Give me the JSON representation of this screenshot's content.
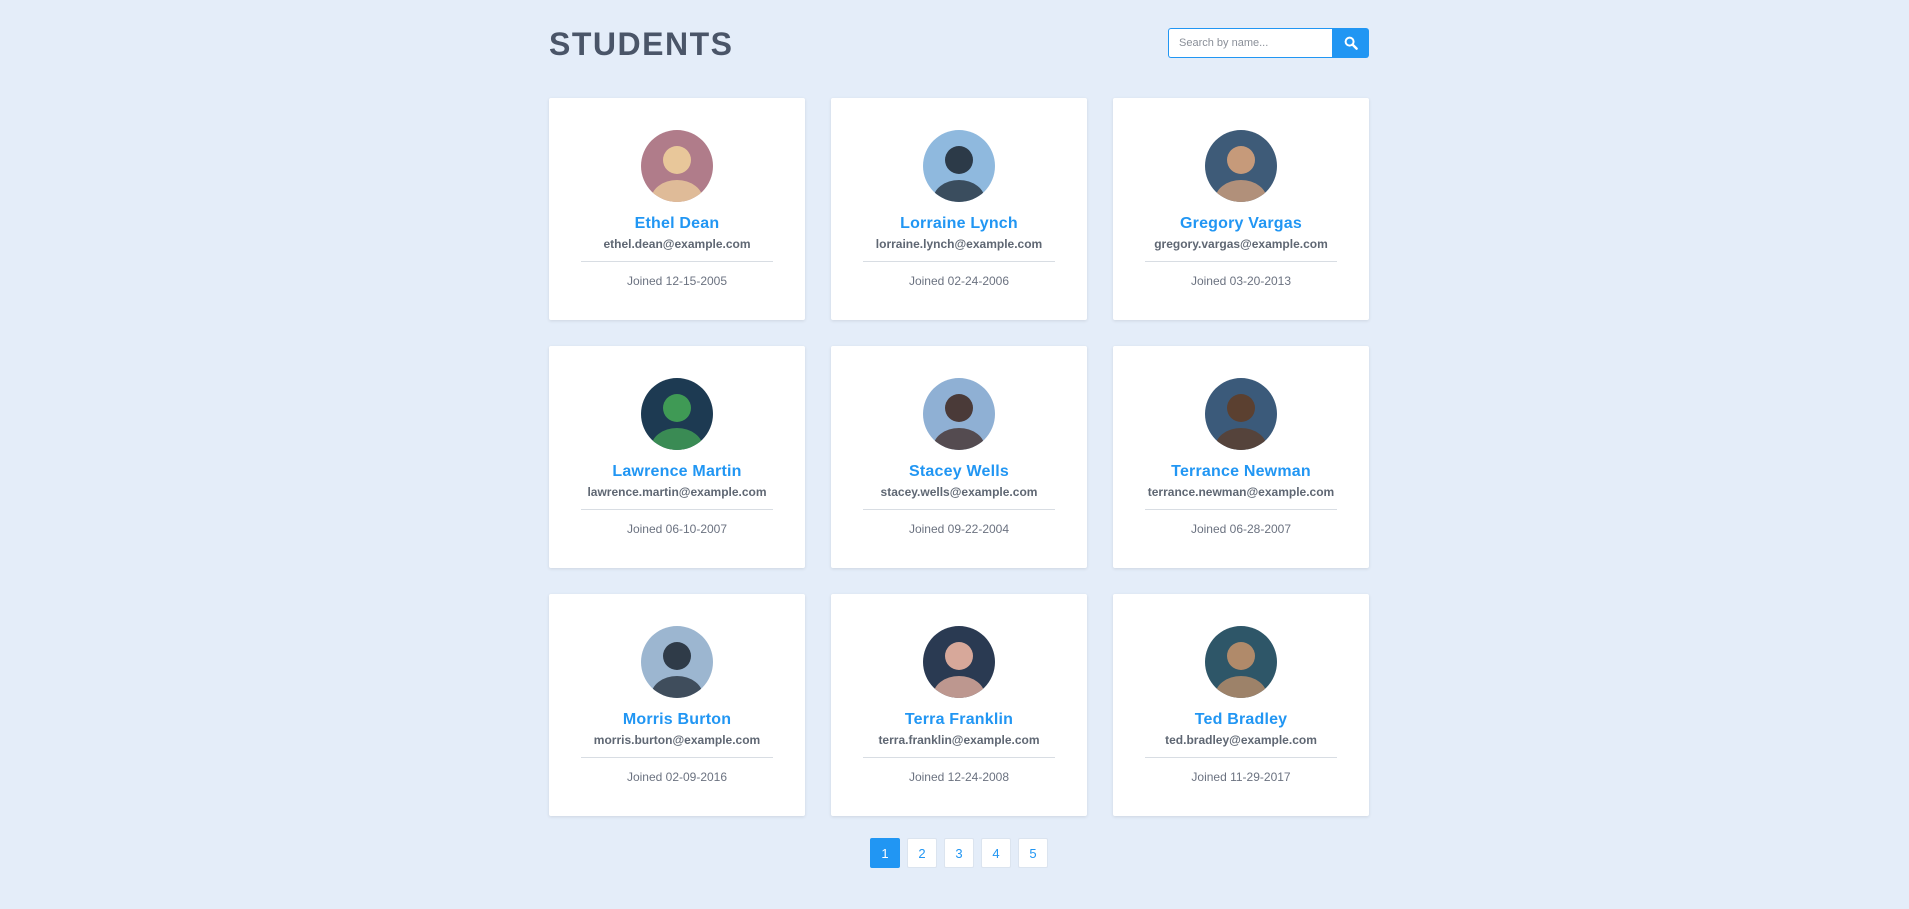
{
  "header": {
    "title": "STUDENTS",
    "search_placeholder": "Search by name...",
    "search_icon": "search-icon"
  },
  "colors": {
    "accent": "#2196f3",
    "background": "#e4edf9",
    "title": "#4a5568"
  },
  "students": [
    {
      "name": "Ethel Dean",
      "email": "ethel.dean@example.com",
      "joined": "Joined 12-15-2005",
      "avatar_bg": "#b07c8a",
      "avatar_fg": "#e8c79a"
    },
    {
      "name": "Lorraine Lynch",
      "email": "lorraine.lynch@example.com",
      "joined": "Joined 02-24-2006",
      "avatar_bg": "#8fb9de",
      "avatar_fg": "#2c3a48"
    },
    {
      "name": "Gregory Vargas",
      "email": "gregory.vargas@example.com",
      "joined": "Joined 03-20-2013",
      "avatar_bg": "#3e5b78",
      "avatar_fg": "#c69a7a"
    },
    {
      "name": "Lawrence Martin",
      "email": "lawrence.martin@example.com",
      "joined": "Joined 06-10-2007",
      "avatar_bg": "#1d3a52",
      "avatar_fg": "#3f9a55"
    },
    {
      "name": "Stacey Wells",
      "email": "stacey.wells@example.com",
      "joined": "Joined 09-22-2004",
      "avatar_bg": "#8fb0d4",
      "avatar_fg": "#4a3a38"
    },
    {
      "name": "Terrance Newman",
      "email": "terrance.newman@example.com",
      "joined": "Joined 06-28-2007",
      "avatar_bg": "#3b5a7a",
      "avatar_fg": "#5b4030"
    },
    {
      "name": "Morris Burton",
      "email": "morris.burton@example.com",
      "joined": "Joined 02-09-2016",
      "avatar_bg": "#9cb6d0",
      "avatar_fg": "#2f3b48"
    },
    {
      "name": "Terra Franklin",
      "email": "terra.franklin@example.com",
      "joined": "Joined 12-24-2008",
      "avatar_bg": "#2a3a52",
      "avatar_fg": "#d7a89a"
    },
    {
      "name": "Ted Bradley",
      "email": "ted.bradley@example.com",
      "joined": "Joined 11-29-2017",
      "avatar_bg": "#2e5668",
      "avatar_fg": "#b08a6a"
    }
  ],
  "pagination": {
    "pages": [
      "1",
      "2",
      "3",
      "4",
      "5"
    ],
    "active": "1"
  }
}
